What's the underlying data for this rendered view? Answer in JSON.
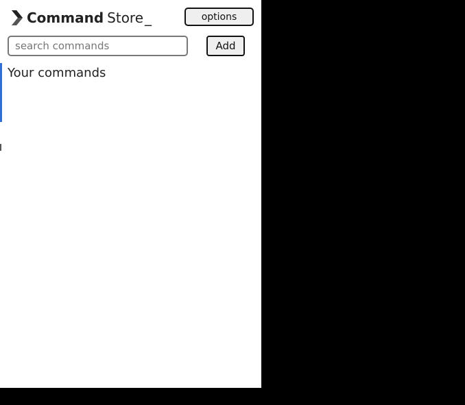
{
  "header": {
    "brand_strong": "Command",
    "brand_light": "Store",
    "brand_cursor": "_",
    "logo_icon": "chevron-right-icon"
  },
  "toolbar": {
    "options_label": "options",
    "add_label": "Add"
  },
  "search": {
    "placeholder": "search commands",
    "value": ""
  },
  "main": {
    "section_title": "Your commands"
  },
  "colors": {
    "panel_bg": "#ffffff",
    "outside_bg": "#000000",
    "text": "#222222",
    "button_bg": "#efefef",
    "accent_sliver": "#2f6fd6"
  }
}
